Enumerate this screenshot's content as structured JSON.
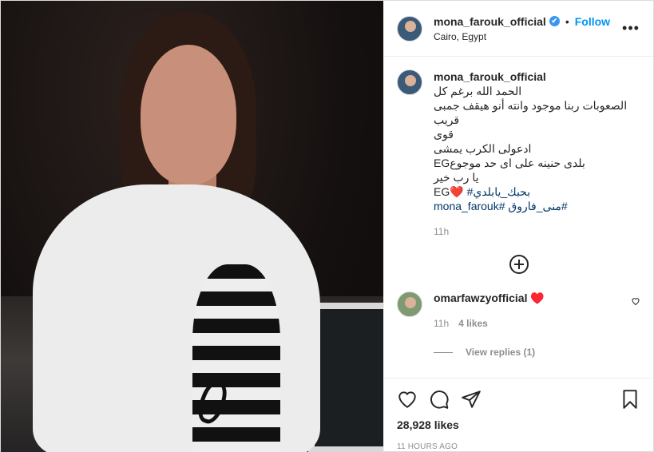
{
  "post": {
    "username": "mona_farouk_official",
    "verified_mark": "✔",
    "dot": "•",
    "follow_label": "Follow",
    "location": "Cairo, Egypt",
    "more_icon": "more-options-icon"
  },
  "caption": {
    "username": "mona_farouk_official",
    "lines": [
      "الحمد الله برغم كل",
      "الصعوبات ربنا موجود وانته أنو هيقف جمبى قريب",
      "قوى",
      "ادعولى الكرب يمشى ",
      "بلدى حنينه على اى حد موجوعEG",
      "يا رب خير",
      "EG❤️"
    ],
    "hashtag_line1": "#بحبك_يابلدي",
    "hashtag_line2_a": "#منى_فاروق",
    "hashtag_line2_b": "#mona_farouk",
    "time": "11h"
  },
  "comment": {
    "username": "omarfawzyofficial",
    "text": "♥️",
    "time": "11h",
    "likes": "4 likes",
    "view_replies": "View replies (1)"
  },
  "footer": {
    "likes": "28,928 likes",
    "ago": "11 HOURS AGO"
  }
}
